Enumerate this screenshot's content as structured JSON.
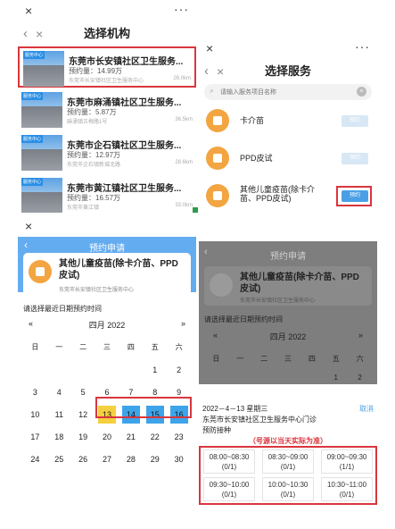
{
  "panel1": {
    "close_icon": "×",
    "more_icon": "···",
    "back_icon": "‹",
    "title": "选择机构",
    "institutions": [
      {
        "tag": "服务中心",
        "name": "东莞市长安镇社区卫生服务...",
        "booked": "预约量：14.99万",
        "address": "东莞市长安镇社区卫生服务中心",
        "distance": "26.0km"
      },
      {
        "tag": "服务中心",
        "name": "东莞市麻涌镇社区卫生服务...",
        "booked": "预约量：5.87万",
        "address": "麻涌镇古梅路1号",
        "distance": "36.5km"
      },
      {
        "tag": "服务中心",
        "name": "东莞市企石镇社区卫生服务...",
        "booked": "预约量：12.97万",
        "address": "东莞市企石镇新城北路",
        "distance": "28.6km"
      },
      {
        "tag": "服务中心",
        "name": "东莞市黄江镇社区卫生服务...",
        "booked": "预约量：16.57万",
        "address": "东莞市黄江镇",
        "distance": "33.0km"
      }
    ]
  },
  "panel2": {
    "close_icon": "×",
    "more_icon": "···",
    "back_icon": "‹",
    "title": "选择服务",
    "search_placeholder": "请输入服务项目名称",
    "search_icon": "⌕",
    "clear_icon": "×",
    "services": [
      {
        "name": "卡介苗",
        "button": "预约"
      },
      {
        "name": "PPD皮试",
        "button": "预约"
      },
      {
        "name": "其他儿童疫苗(除卡介苗、PPD皮试)",
        "button": "预约"
      }
    ]
  },
  "panel3": {
    "close_icon": "×",
    "back_icon": "‹",
    "header_title": "预约申请",
    "vaccine_title": "其他儿童疫苗(除卡介苗、PPD皮试)",
    "address": "东莞市长安镇社区卫生服务中心",
    "prompt": "请选择最近日期预约时间",
    "prev": "«",
    "next": "»",
    "month": "四月 2022",
    "weekdays": [
      "日",
      "一",
      "二",
      "三",
      "四",
      "五",
      "六"
    ],
    "weeks": [
      [
        "",
        "",
        "",
        "",
        "",
        "1",
        "2"
      ],
      [
        "3",
        "4",
        "5",
        "6",
        "7",
        "8",
        "9"
      ],
      [
        "10",
        "11",
        "12",
        "13",
        "14",
        "15",
        "16"
      ],
      [
        "17",
        "18",
        "19",
        "20",
        "21",
        "22",
        "23"
      ],
      [
        "24",
        "25",
        "26",
        "27",
        "28",
        "29",
        "30"
      ]
    ],
    "highlight_selected": "13",
    "highlight_available": [
      "14",
      "15",
      "16"
    ],
    "colors": {
      "header": "#64acf0",
      "available": "#3ea4ea",
      "selected": "#f4d03f",
      "highlight_box": "#d9363e"
    }
  },
  "panel4": {
    "back_icon": "‹",
    "header_title": "预约申请",
    "vaccine_title": "其他儿童疫苗(除卡介苗、PPD皮试)",
    "address": "东莞市长安镇社区卫生服务中心",
    "prompt": "请选择最近日期预约时间",
    "prev": "«",
    "next": "»",
    "month": "四月 2022",
    "weekdays": [
      "日",
      "一",
      "二",
      "三",
      "四",
      "五",
      "六"
    ],
    "first_week": [
      "",
      "",
      "",
      "",
      "",
      "1",
      "2"
    ],
    "selected_date": "2022－4－13 星期三",
    "cancel": "取消",
    "place": "东莞市长安镇社区卫生服务中心门诊",
    "service_type": "预防接种",
    "note": "（号源以当天实际为准）",
    "slots": [
      {
        "time": "08:00~08:30",
        "count": "(0/1)"
      },
      {
        "time": "08:30~09:00",
        "count": "(0/1)"
      },
      {
        "time": "09:00~09:30",
        "count": "(1/1)"
      },
      {
        "time": "09:30~10:00",
        "count": "(0/1)"
      },
      {
        "time": "10:00~10:30",
        "count": "(0/1)"
      },
      {
        "time": "10:30~11:00",
        "count": "(0/1)"
      }
    ]
  }
}
